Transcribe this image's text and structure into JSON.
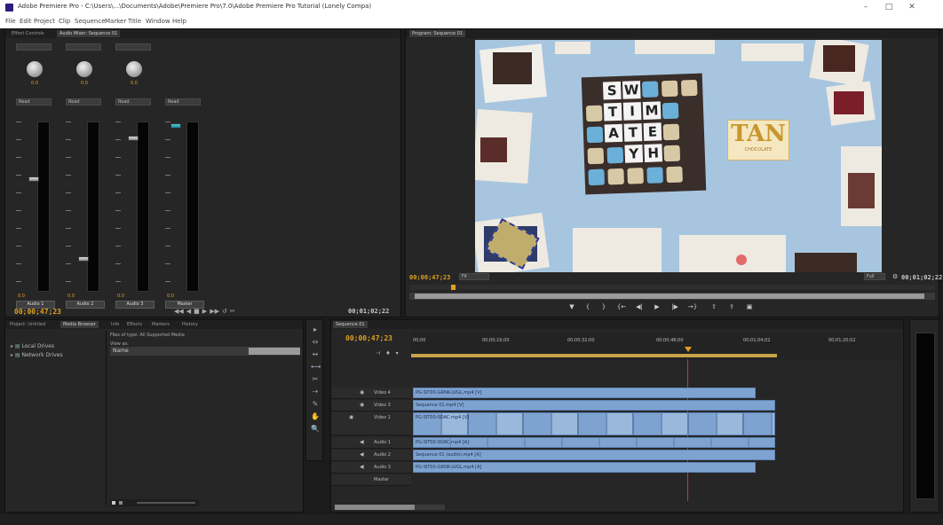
{
  "titlebar": {
    "title": "Adobe Premiere Pro - C:\\Users\\...\\Documents\\Adobe\\Premiere Pro\\7.0\\Adobe Premiere Pro Tutorial (Lonely Compa)",
    "min": "–",
    "max": "□",
    "close": "✕"
  },
  "menu": [
    "File",
    "Edit",
    "Project",
    "Clip",
    "Sequence",
    "Marker",
    "Title",
    "Window",
    "Help"
  ],
  "mixer": {
    "tabs": [
      "Effect Controls",
      "Audio Mixer: Sequence 01"
    ],
    "timecode_left": "00;00;47;23",
    "timecode_right": "00;01;02;22",
    "channels": [
      {
        "name": "Audio 1",
        "value": "0.0",
        "read": "Read",
        "db": "0.0"
      },
      {
        "name": "Audio 2",
        "value": "0.0",
        "read": "Read",
        "db": "0.0"
      },
      {
        "name": "Audio 3",
        "value": "0.0",
        "read": "Read",
        "db": "0.0"
      },
      {
        "name": "Master",
        "value": "",
        "read": "Read",
        "db": "0.0"
      }
    ],
    "routing": [
      "Audio 1",
      "Master",
      "Master",
      ""
    ],
    "transport": [
      "◀◀",
      "◀",
      "■",
      "▶",
      "▶▶",
      "↺",
      "✂"
    ]
  },
  "program": {
    "tab": "Program: Sequence 01",
    "timecode": "00;00;47;23",
    "fit": "Fit",
    "full": "Full",
    "duration": "00;01;02;22",
    "letters": [
      [
        "S",
        "W"
      ],
      [
        "T",
        "I",
        "M"
      ],
      [
        "A",
        "T",
        "E"
      ],
      [
        "Y",
        "H"
      ]
    ],
    "sign_word": "TAN",
    "sign_sub": "CHOCOLATE"
  },
  "project": {
    "tabs": [
      "Project: Untitled",
      "Media Browser",
      "Info",
      "Effects",
      "Markers",
      "History"
    ],
    "items": [
      "Local Drives",
      "Network Drives"
    ],
    "files_of_type": "Files of type: All Supported Media",
    "view_as": "View as:",
    "name_col": "Name"
  },
  "tools": [
    "▸",
    "⇔",
    "↔",
    "⟷",
    "✂",
    "⇢",
    "✎",
    "✋",
    "🔍"
  ],
  "timeline": {
    "tab": "Sequence 01",
    "timecode": "00;00;47;23",
    "ruler": [
      "00;00",
      "00;00;16;00",
      "00;00;32;00",
      "00;00;48;00",
      "00;01;04;02",
      "00;01;20;02"
    ],
    "tracks": [
      {
        "label": "Video 4",
        "clip": "PG-SIT00-GRNK-LVGL.mp4 [V]"
      },
      {
        "label": "Video 3",
        "clip": "Sequence 01.mp4 [V]"
      },
      {
        "label": "Video 1",
        "clip": "PG-SIT00-SOAC.mp4 [V]"
      },
      {
        "label": "Audio 1",
        "clip": "PG-SIT00-SOAC.mp4 [A]"
      },
      {
        "label": "Audio 2",
        "clip": "Sequence 01 (audio).mp4 [A]"
      },
      {
        "label": "Audio 3",
        "clip": "PG-SIT00-GRNK-LVGL.mp4 [A]"
      },
      {
        "label": "Master",
        "clip": ""
      }
    ]
  },
  "colors": {
    "accent": "#e0a020",
    "clip": "#7ea3d0",
    "panel": "#262626",
    "bg": "#1b1b1b"
  }
}
